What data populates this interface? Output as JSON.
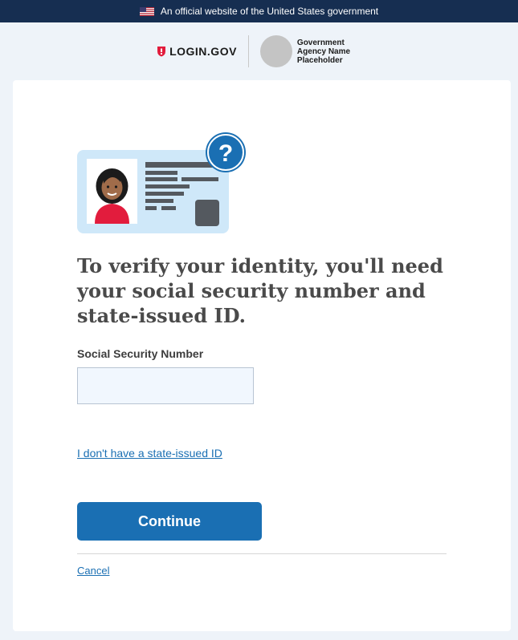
{
  "banner": {
    "text": "An official website of the United States government",
    "flag_icon": "us-flag-icon"
  },
  "header": {
    "logo_text": "LOGIN.GOV",
    "logo_icon": "shield-icon",
    "agency_name": "Government Agency Name Placeholder"
  },
  "main": {
    "heading": "To verify your identity, you'll need your social security number and state-issued ID.",
    "ssn_label": "Social Security Number",
    "ssn_value": "",
    "no_id_link": "I don't have a state-issued ID",
    "continue_label": "Continue",
    "cancel_label": "Cancel"
  },
  "colors": {
    "banner_bg": "#162e51",
    "primary": "#1a6fb3",
    "page_bg": "#eef3f9",
    "input_bg": "#f1f7fe",
    "id_card_bg": "#cfe8f9",
    "question_badge": "#1a6fb3",
    "shield_red": "#e21c3d"
  }
}
